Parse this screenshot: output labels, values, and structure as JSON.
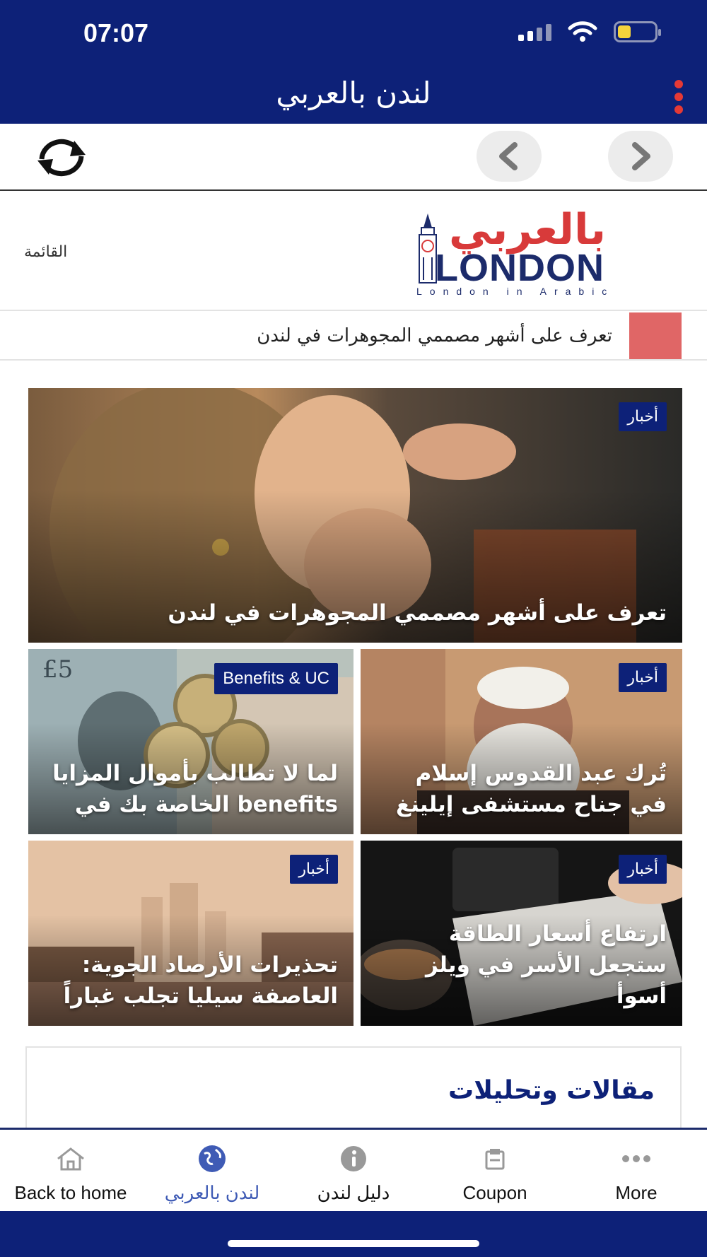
{
  "status_bar": {
    "time": "07:07",
    "battery_level": 0.35
  },
  "app_bar": {
    "title": "لندن بالعربي"
  },
  "site_header": {
    "menu_label": "القائمة",
    "logo": {
      "arabic": "بالعربي",
      "latin": "LONDON",
      "tagline": "London in Arabic"
    }
  },
  "ticker": {
    "text": "تعرف على أشهر مصممي المجوهرات في لندن"
  },
  "cards": [
    {
      "category": "أخبار",
      "title": "تعرف على أشهر مصممي المجوهرات في لندن",
      "image": "woman-with-earrings"
    },
    {
      "category": "أخبار",
      "title": "تُرك عبد القدوس إسلام في جناح مستشفى إيلينغ",
      "image": "elderly-man"
    },
    {
      "category": "Benefits & UC",
      "title": "لما لا تطالب بأموال المزايا benefits الخاصة بك في",
      "image": "pound-coins-and-notes"
    },
    {
      "category": "أخبار",
      "title": "ارتفاع أسعار الطاقة ستجعل الأسر في ويلز أسوأ",
      "image": "energy-bill-and-meter"
    },
    {
      "category": "أخبار",
      "title": "تحذيرات الأرصاد الجوية: العاصفة سيليا تجلب غباراً",
      "image": "hazy-london-skyline"
    }
  ],
  "section": {
    "title": "مقالات وتحليلات"
  },
  "tab_bar": {
    "items": [
      {
        "label": "Back to home",
        "icon": "home-icon"
      },
      {
        "label": "لندن بالعربي",
        "icon": "globe-icon",
        "active": true
      },
      {
        "label": "دليل لندن",
        "icon": "info-icon"
      },
      {
        "label": "Coupon",
        "icon": "coupon-icon"
      },
      {
        "label": "More",
        "icon": "more-icon"
      }
    ]
  },
  "colors": {
    "brand_navy": "#0d2178",
    "accent_red": "#e06666",
    "active_tab": "#3f5bb5"
  }
}
